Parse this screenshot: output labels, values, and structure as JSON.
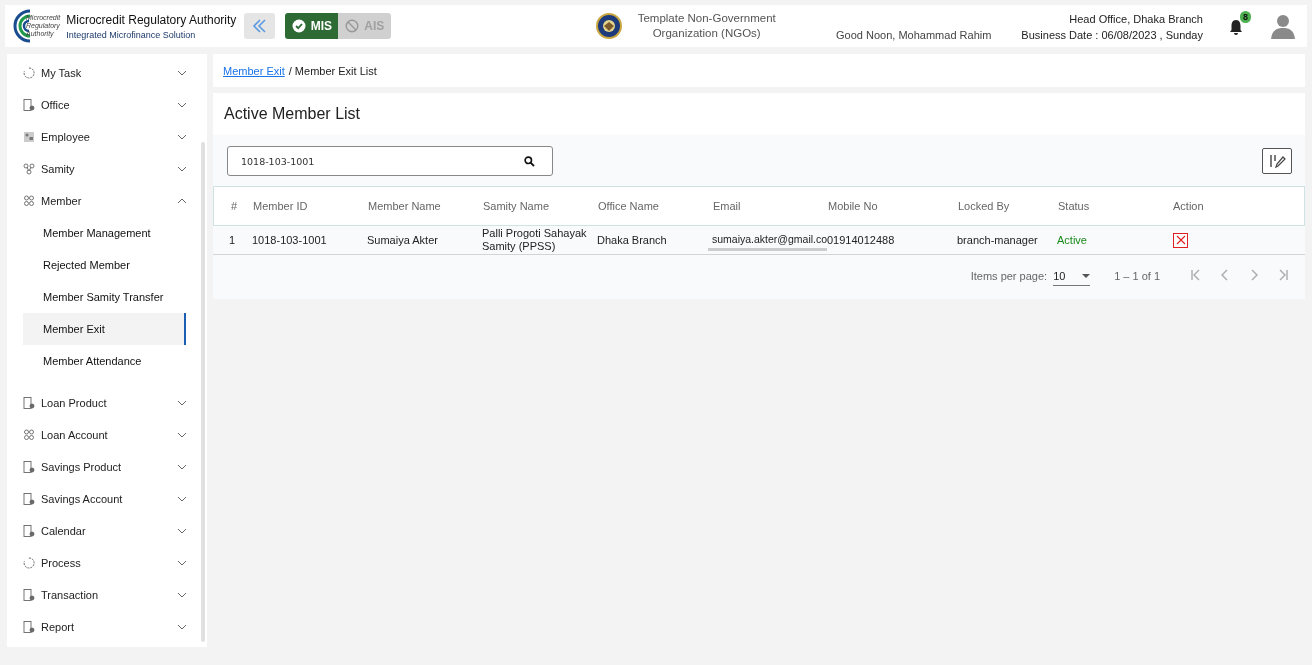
{
  "header": {
    "org_name": "Microcredit Regulatory Authority",
    "org_subtitle": "Integrated Microfinance Solution",
    "logo_text": [
      "Microcredit",
      "Regulatory",
      "Authority"
    ],
    "modes": [
      {
        "label": "MIS",
        "selected": true
      },
      {
        "label": "AIS",
        "selected": false
      }
    ],
    "ngo_name": "Template Non-Government Organization (NGOs)",
    "greeting": "Good Noon, Mohammad Rahim",
    "office": "Head Office, Dhaka Branch",
    "business_date": "Business Date : 06/08/2023 , Sunday",
    "notification_count": "8"
  },
  "sidebar": {
    "items": [
      {
        "label": "My Task",
        "kind": "cycle",
        "expanded": false
      },
      {
        "label": "Office",
        "kind": "document",
        "expanded": false
      },
      {
        "label": "Employee",
        "kind": "badge",
        "expanded": false
      },
      {
        "label": "Samity",
        "kind": "network",
        "expanded": false
      },
      {
        "label": "Member",
        "kind": "people",
        "expanded": true,
        "children": [
          {
            "label": "Member Management",
            "selected": false
          },
          {
            "label": "Rejected Member",
            "selected": false
          },
          {
            "label": "Member Samity Transfer",
            "selected": false
          },
          {
            "label": "Member Exit",
            "selected": true
          },
          {
            "label": "Member Attendance",
            "selected": false
          }
        ]
      },
      {
        "label": "Loan Product",
        "kind": "document",
        "expanded": false
      },
      {
        "label": "Loan Account",
        "kind": "people",
        "expanded": false
      },
      {
        "label": "Savings Product",
        "kind": "document",
        "expanded": false
      },
      {
        "label": "Savings Account",
        "kind": "document",
        "expanded": false
      },
      {
        "label": "Calendar",
        "kind": "document",
        "expanded": false
      },
      {
        "label": "Process",
        "kind": "cycle",
        "expanded": false
      },
      {
        "label": "Transaction",
        "kind": "document",
        "expanded": false
      },
      {
        "label": "Report",
        "kind": "document",
        "expanded": false
      }
    ]
  },
  "breadcrumb": [
    {
      "label": "Member Exit",
      "kind": "link"
    },
    {
      "label": "/ Member Exit List",
      "kind": "text"
    }
  ],
  "page_title": "Active Member List",
  "search": {
    "value": "1018-103-1001"
  },
  "table": {
    "columns": [
      "#",
      "Member ID",
      "Member Name",
      "Samity Name",
      "Office Name",
      "Email",
      "Mobile No",
      "Locked By",
      "Status",
      "Action"
    ],
    "rows": [
      {
        "cells": [
          "1",
          "1018-103-1001",
          "Sumaiya Akter",
          "Palli Progoti Sahayak Samity (PPSS)",
          "Dhaka Branch",
          "sumaiya.akter@gmail.co",
          "01914012488",
          "branch-manager",
          "Active"
        ]
      }
    ]
  },
  "pagination": {
    "items_label": "Items per page:",
    "page_size": "10",
    "range": "1 – 1 of 1",
    "buttons": [
      {
        "kind": "first",
        "disabled": true
      },
      {
        "kind": "prev",
        "disabled": true
      },
      {
        "kind": "next",
        "disabled": true
      },
      {
        "kind": "last",
        "disabled": true
      }
    ]
  }
}
